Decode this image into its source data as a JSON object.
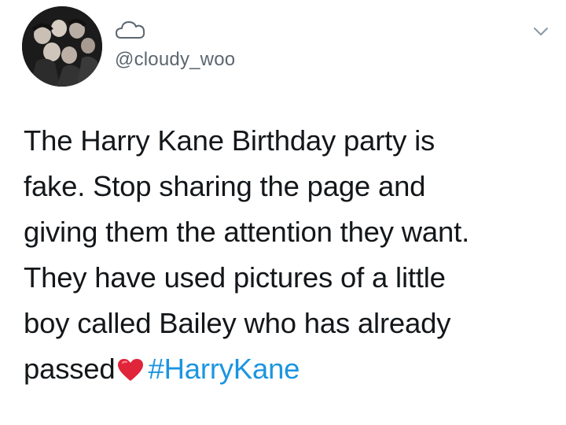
{
  "tweet": {
    "display_name_icon": "cloud-icon",
    "handle": "@cloudy_woo",
    "lines": [
      "The Harry Kane Birthday party is",
      "fake. Stop sharing the page and",
      "giving them the attention they want.",
      "They have used pictures of a little",
      "boy called Bailey who has already"
    ],
    "last_line_text": "passed",
    "emoji": "red-heart-icon",
    "hashtag": "#HarryKane"
  },
  "colors": {
    "text": "#14171a",
    "handle": "#5b6670",
    "hashtag": "#1b95e0",
    "heart": "#e0243a"
  }
}
